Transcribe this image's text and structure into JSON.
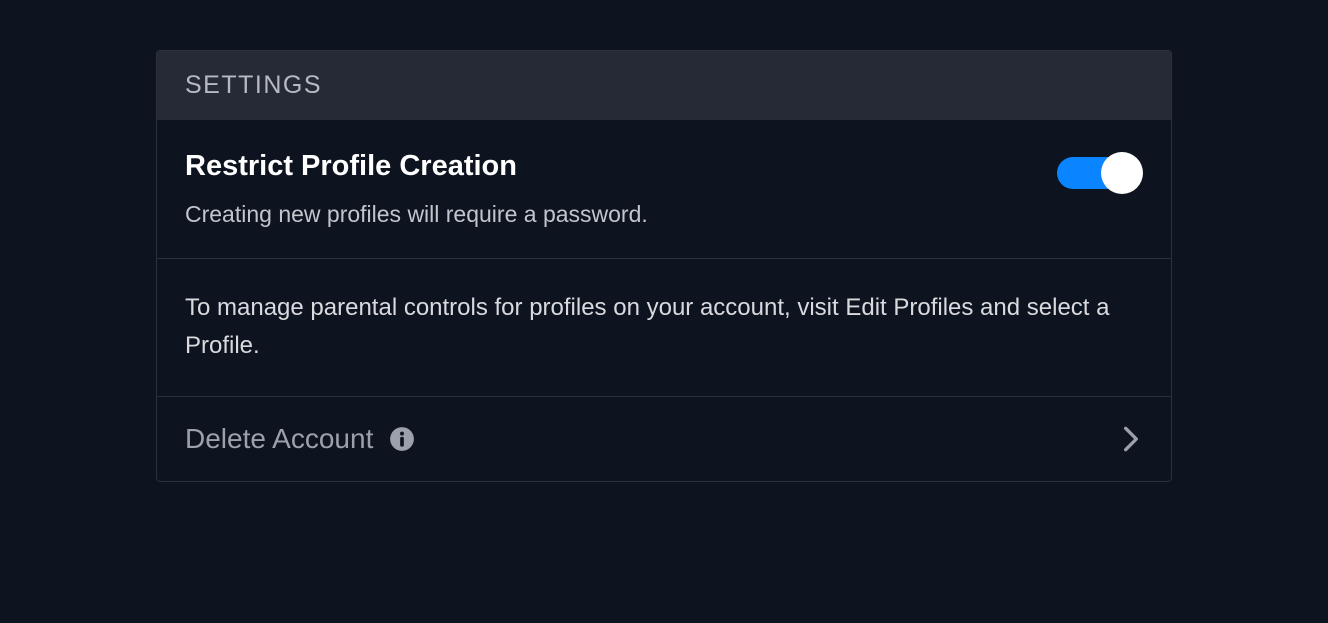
{
  "panel": {
    "title": "SETTINGS"
  },
  "restrict": {
    "title": "Restrict Profile Creation",
    "description": "Creating new profiles will require a password.",
    "enabled": true
  },
  "parental": {
    "text": "To manage parental controls for profiles on your account, visit Edit Profiles and select a Profile."
  },
  "delete": {
    "label": "Delete Account"
  }
}
